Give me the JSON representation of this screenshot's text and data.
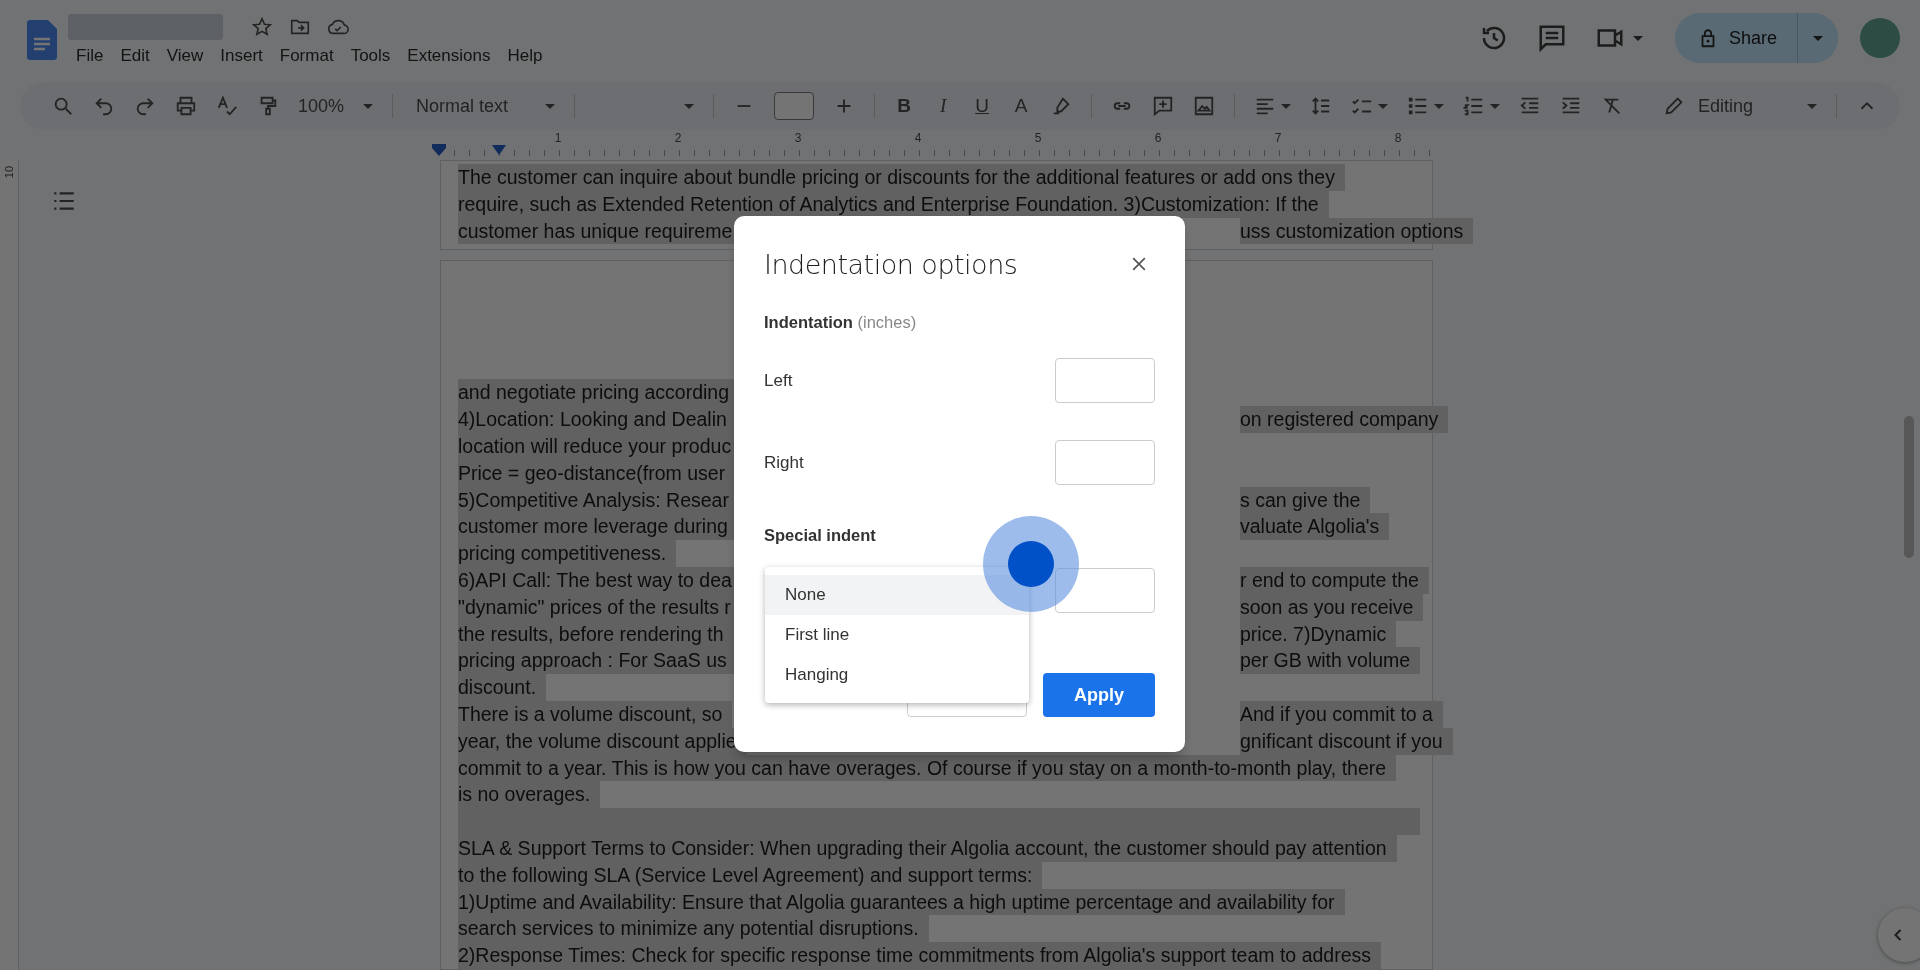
{
  "menu_bar": [
    "File",
    "Edit",
    "View",
    "Insert",
    "Format",
    "Tools",
    "Extensions",
    "Help"
  ],
  "toolbar": {
    "zoom": "100%",
    "style": "Normal text",
    "format_letters": [
      "B",
      "I",
      "U",
      "A"
    ],
    "mode": "Editing"
  },
  "share": {
    "label": "Share"
  },
  "ruler": {
    "marks": [
      "1",
      "2",
      "3",
      "4",
      "5",
      "6",
      "7",
      "8"
    ],
    "vertical_mark": "10"
  },
  "page_1": [
    {
      "left": "The customer can inquire about bundle pricing or discounts for the additional features or add ons they"
    },
    {
      "left": "require, such as Extended Retention of Analytics and Enterprise Foundation. 3)Customization: If the"
    },
    {
      "left": "customer has unique requireme",
      "right": "uss  customization options"
    }
  ],
  "page_2": [
    {
      "left": "and negotiate pricing according"
    },
    {
      "left": "4)Location: Looking and Dealin",
      "right": "on registered company"
    },
    {
      "left": "location will reduce your produc"
    },
    {
      "left": "Price = geo-distance(from user"
    },
    {
      "left": "5)Competitive Analysis: Resear",
      "right": "s can give the"
    },
    {
      "left": "customer  more leverage during",
      "right": "valuate Algolia's"
    },
    {
      "left": "pricing  competitiveness."
    },
    {
      "left": "6)API Call: The best way to dea",
      "right": "r end to compute the"
    },
    {
      "left": "\"dynamic\" prices of the results r",
      "right": "soon as you receive"
    },
    {
      "left": "the  results, before rendering th",
      "right": "price. 7)Dynamic"
    },
    {
      "left": "pricing approach : For SaaS us",
      "right": "per GB with  volume"
    },
    {
      "left": "discount."
    },
    {
      "left": "There is a volume discount, so",
      "right": "And if you commit to a"
    },
    {
      "left": "year, the volume discount applie",
      "right": "gnificant discount if you"
    },
    {
      "left": "commit to a year. This is how you can have overages. Of course if you stay on a month-to-month play, there"
    },
    {
      "left": "is no overages."
    },
    {
      "kind": "blank"
    },
    {
      "left": "SLA & Support Terms to Consider: When upgrading their Algolia account, the customer should pay attention"
    },
    {
      "left": "to the following SLA (Service Level Agreement) and support terms:"
    },
    {
      "left": "1)Uptime and Availability: Ensure that Algolia guarantees a high uptime percentage and availability for"
    },
    {
      "left": "search  services to minimize any potential disruptions."
    },
    {
      "left": "2)Response Times: Check for specific response time commitments from Algolia's support team to address"
    }
  ],
  "dialog": {
    "title": "Indentation options",
    "section": "Indentation",
    "unit": "(inches)",
    "fields": [
      {
        "label": "Left"
      },
      {
        "label": "Right"
      }
    ],
    "special_label": "Special indent",
    "options": [
      {
        "label": "None",
        "selected": true
      },
      {
        "label": "First line",
        "selected": false
      },
      {
        "label": "Hanging",
        "selected": false
      }
    ],
    "apply": "Apply"
  }
}
